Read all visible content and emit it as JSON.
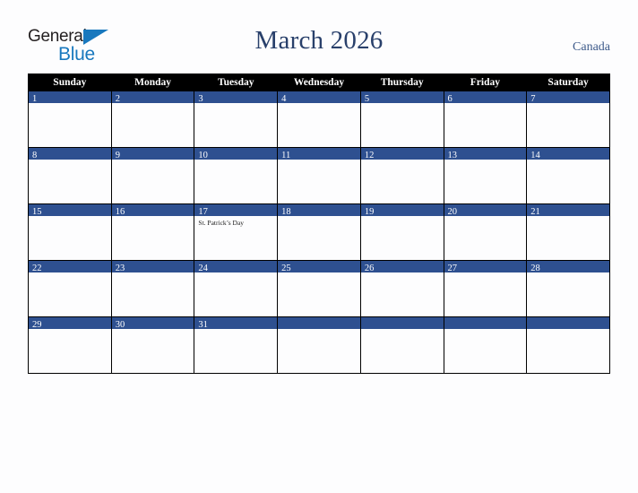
{
  "brand": {
    "name_part1": "General",
    "name_part2": "Blue",
    "triangle_icon": "triangle-icon",
    "color_dark": "#231f20",
    "color_blue": "#1878be"
  },
  "header": {
    "title": "March 2026",
    "region": "Canada",
    "title_color": "#29406b"
  },
  "calendar": {
    "weekday_headers": [
      "Sunday",
      "Monday",
      "Tuesday",
      "Wednesday",
      "Thursday",
      "Friday",
      "Saturday"
    ],
    "header_bg": "#000000",
    "daynum_bg": "#2e5090",
    "cell_bg": "#fdfdfe",
    "weeks": [
      [
        {
          "day": "1",
          "events": []
        },
        {
          "day": "2",
          "events": []
        },
        {
          "day": "3",
          "events": []
        },
        {
          "day": "4",
          "events": []
        },
        {
          "day": "5",
          "events": []
        },
        {
          "day": "6",
          "events": []
        },
        {
          "day": "7",
          "events": []
        }
      ],
      [
        {
          "day": "8",
          "events": []
        },
        {
          "day": "9",
          "events": []
        },
        {
          "day": "10",
          "events": []
        },
        {
          "day": "11",
          "events": []
        },
        {
          "day": "12",
          "events": []
        },
        {
          "day": "13",
          "events": []
        },
        {
          "day": "14",
          "events": []
        }
      ],
      [
        {
          "day": "15",
          "events": []
        },
        {
          "day": "16",
          "events": []
        },
        {
          "day": "17",
          "events": [
            "St. Patrick’s Day"
          ]
        },
        {
          "day": "18",
          "events": []
        },
        {
          "day": "19",
          "events": []
        },
        {
          "day": "20",
          "events": []
        },
        {
          "day": "21",
          "events": []
        }
      ],
      [
        {
          "day": "22",
          "events": []
        },
        {
          "day": "23",
          "events": []
        },
        {
          "day": "24",
          "events": []
        },
        {
          "day": "25",
          "events": []
        },
        {
          "day": "26",
          "events": []
        },
        {
          "day": "27",
          "events": []
        },
        {
          "day": "28",
          "events": []
        }
      ],
      [
        {
          "day": "29",
          "events": []
        },
        {
          "day": "30",
          "events": []
        },
        {
          "day": "31",
          "events": []
        },
        {
          "day": "",
          "events": []
        },
        {
          "day": "",
          "events": []
        },
        {
          "day": "",
          "events": []
        },
        {
          "day": "",
          "events": []
        }
      ]
    ]
  }
}
